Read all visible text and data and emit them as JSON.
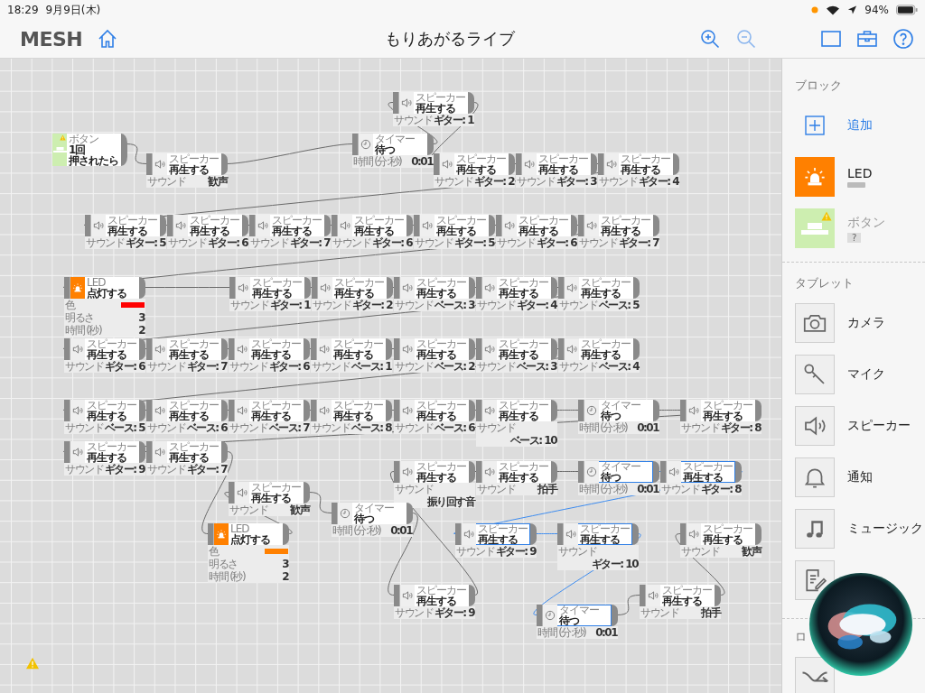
{
  "status_bar": {
    "time": "18:29",
    "date": "9月9日(木)",
    "battery": "94%"
  },
  "header": {
    "logo": "MESH",
    "title": "もりあがるライブ"
  },
  "nodes": [
    {
      "kind": "button",
      "title": "ボタン",
      "count": "1回",
      "action": "押されたら",
      "selected": false,
      "warning": true
    },
    {
      "kind": "speaker",
      "title": "スピーカー",
      "action": "再生する",
      "selected": false,
      "params": [
        {
          "label": "サウンド",
          "value": "歓声"
        }
      ]
    },
    {
      "kind": "timer",
      "title": "タイマー",
      "action": "待つ",
      "selected": false,
      "params": [
        {
          "label": "時間 (分:秒)",
          "value": "0:01"
        }
      ]
    },
    {
      "kind": "speaker",
      "title": "スピーカー",
      "action": "再生する",
      "selected": false,
      "params": [
        {
          "label": "サウンド",
          "value": "ギター: 1"
        }
      ]
    },
    {
      "kind": "speaker",
      "title": "スピーカー",
      "action": "再生する",
      "selected": false,
      "params": [
        {
          "label": "サウンド",
          "value": "ギター: 2"
        }
      ]
    },
    {
      "kind": "speaker",
      "title": "スピーカー",
      "action": "再生する",
      "selected": false,
      "params": [
        {
          "label": "サウンド",
          "value": "ギター: 3"
        }
      ]
    },
    {
      "kind": "speaker",
      "title": "スピーカー",
      "action": "再生する",
      "selected": false,
      "params": [
        {
          "label": "サウンド",
          "value": "ギター: 4"
        }
      ]
    },
    {
      "kind": "speaker",
      "title": "スピーカー",
      "action": "再生する",
      "selected": false,
      "params": [
        {
          "label": "サウンド",
          "value": "ギター: 5"
        }
      ]
    },
    {
      "kind": "speaker",
      "title": "スピーカー",
      "action": "再生する",
      "selected": false,
      "params": [
        {
          "label": "サウンド",
          "value": "ギター: 6"
        }
      ]
    },
    {
      "kind": "speaker",
      "title": "スピーカー",
      "action": "再生する",
      "selected": false,
      "params": [
        {
          "label": "サウンド",
          "value": "ギター: 7"
        }
      ]
    },
    {
      "kind": "speaker",
      "title": "スピーカー",
      "action": "再生する",
      "selected": false,
      "params": [
        {
          "label": "サウンド",
          "value": "ギター: 6"
        }
      ]
    },
    {
      "kind": "speaker",
      "title": "スピーカー",
      "action": "再生する",
      "selected": false,
      "params": [
        {
          "label": "サウンド",
          "value": "ギター: 5"
        }
      ]
    },
    {
      "kind": "speaker",
      "title": "スピーカー",
      "action": "再生する",
      "selected": false,
      "params": [
        {
          "label": "サウンド",
          "value": "ギター: 6"
        }
      ]
    },
    {
      "kind": "speaker",
      "title": "スピーカー",
      "action": "再生する",
      "selected": false,
      "params": [
        {
          "label": "サウンド",
          "value": "ギター: 7"
        }
      ]
    },
    {
      "kind": "led",
      "title": "LED",
      "action": "点灯する",
      "selected": false,
      "params": [
        {
          "label": "色",
          "color": "#ff0000"
        },
        {
          "label": "明るさ",
          "value": "3"
        },
        {
          "label": "時間 (秒)",
          "value": "2"
        }
      ]
    },
    {
      "kind": "speaker",
      "title": "スピーカー",
      "action": "再生する",
      "selected": false,
      "params": [
        {
          "label": "サウンド",
          "value": "ギター: 1"
        }
      ]
    },
    {
      "kind": "speaker",
      "title": "スピーカー",
      "action": "再生する",
      "selected": false,
      "params": [
        {
          "label": "サウンド",
          "value": "ギター: 2"
        }
      ]
    },
    {
      "kind": "speaker",
      "title": "スピーカー",
      "action": "再生する",
      "selected": false,
      "params": [
        {
          "label": "サウンド",
          "value": "ベース: 3"
        }
      ]
    },
    {
      "kind": "speaker",
      "title": "スピーカー",
      "action": "再生する",
      "selected": false,
      "params": [
        {
          "label": "サウンド",
          "value": "ギター: 4"
        }
      ]
    },
    {
      "kind": "speaker",
      "title": "スピーカー",
      "action": "再生する",
      "selected": false,
      "params": [
        {
          "label": "サウンド",
          "value": "ベース: 5"
        }
      ]
    },
    {
      "kind": "speaker",
      "title": "スピーカー",
      "action": "再生する",
      "selected": false,
      "params": [
        {
          "label": "サウンド",
          "value": "ギター: 6"
        }
      ]
    },
    {
      "kind": "speaker",
      "title": "スピーカー",
      "action": "再生する",
      "selected": false,
      "params": [
        {
          "label": "サウンド",
          "value": "ギター: 7"
        }
      ]
    },
    {
      "kind": "speaker",
      "title": "スピーカー",
      "action": "再生する",
      "selected": false,
      "params": [
        {
          "label": "サウンド",
          "value": "ギター: 6"
        }
      ]
    },
    {
      "kind": "speaker",
      "title": "スピーカー",
      "action": "再生する",
      "selected": false,
      "params": [
        {
          "label": "サウンド",
          "value": "ベース: 1"
        }
      ]
    },
    {
      "kind": "speaker",
      "title": "スピーカー",
      "action": "再生する",
      "selected": false,
      "params": [
        {
          "label": "サウンド",
          "value": "ベース: 2"
        }
      ]
    },
    {
      "kind": "speaker",
      "title": "スピーカー",
      "action": "再生する",
      "selected": false,
      "params": [
        {
          "label": "サウンド",
          "value": "ベース: 3"
        }
      ]
    },
    {
      "kind": "speaker",
      "title": "スピーカー",
      "action": "再生する",
      "selected": false,
      "params": [
        {
          "label": "サウンド",
          "value": "ベース: 4"
        }
      ]
    },
    {
      "kind": "speaker",
      "title": "スピーカー",
      "action": "再生する",
      "selected": false,
      "params": [
        {
          "label": "サウンド",
          "value": "ベース: 5"
        }
      ]
    },
    {
      "kind": "speaker",
      "title": "スピーカー",
      "action": "再生する",
      "selected": false,
      "params": [
        {
          "label": "サウンド",
          "value": "ベース: 6"
        }
      ]
    },
    {
      "kind": "speaker",
      "title": "スピーカー",
      "action": "再生する",
      "selected": false,
      "params": [
        {
          "label": "サウンド",
          "value": "ベース: 7"
        }
      ]
    },
    {
      "kind": "speaker",
      "title": "スピーカー",
      "action": "再生する",
      "selected": false,
      "params": [
        {
          "label": "サウンド",
          "value": "ベース: 8"
        }
      ]
    },
    {
      "kind": "speaker",
      "title": "スピーカー",
      "action": "再生する",
      "selected": false,
      "params": [
        {
          "label": "サウンド",
          "value": "ベース: 6"
        }
      ]
    },
    {
      "kind": "speaker",
      "title": "スピーカー",
      "action": "再生する",
      "selected": false,
      "params": [
        {
          "label": "サウンド",
          "value": "ベース: 10"
        }
      ]
    },
    {
      "kind": "timer",
      "title": "タイマー",
      "action": "待つ",
      "selected": false,
      "params": [
        {
          "label": "時間 (分:秒)",
          "value": "0:01"
        }
      ]
    },
    {
      "kind": "speaker",
      "title": "スピーカー",
      "action": "再生する",
      "selected": false,
      "params": [
        {
          "label": "サウンド",
          "value": "ギター: 8"
        }
      ]
    },
    {
      "kind": "speaker",
      "title": "スピーカー",
      "action": "再生する",
      "selected": false,
      "params": [
        {
          "label": "サウンド",
          "value": "ギター: 9"
        }
      ]
    },
    {
      "kind": "speaker",
      "title": "スピーカー",
      "action": "再生する",
      "selected": false,
      "params": [
        {
          "label": "サウンド",
          "value": "ギター: 7"
        }
      ]
    },
    {
      "kind": "speaker",
      "title": "スピーカー",
      "action": "再生する",
      "selected": false,
      "params": [
        {
          "label": "サウンド",
          "value": "振り回す音"
        }
      ]
    },
    {
      "kind": "speaker",
      "title": "スピーカー",
      "action": "再生する",
      "selected": false,
      "params": [
        {
          "label": "サウンド",
          "value": "拍手"
        }
      ]
    },
    {
      "kind": "timer",
      "title": "タイマー",
      "action": "待つ",
      "selected": true,
      "params": [
        {
          "label": "時間 (分:秒)",
          "value": "0:01"
        }
      ]
    },
    {
      "kind": "speaker",
      "title": "スピーカー",
      "action": "再生する",
      "selected": true,
      "params": [
        {
          "label": "サウンド",
          "value": "ギター: 8"
        }
      ]
    },
    {
      "kind": "speaker",
      "title": "スピーカー",
      "action": "再生する",
      "selected": false,
      "params": [
        {
          "label": "サウンド",
          "value": "歓声"
        }
      ]
    },
    {
      "kind": "timer",
      "title": "タイマー",
      "action": "待つ",
      "selected": false,
      "params": [
        {
          "label": "時間 (分:秒)",
          "value": "0:01"
        }
      ]
    },
    {
      "kind": "led",
      "title": "LED",
      "action": "点灯する",
      "selected": false,
      "params": [
        {
          "label": "色",
          "color": "#ff8000"
        },
        {
          "label": "明るさ",
          "value": "3"
        },
        {
          "label": "時間 (秒)",
          "value": "2"
        }
      ]
    },
    {
      "kind": "speaker",
      "title": "スピーカー",
      "action": "再生する",
      "selected": true,
      "params": [
        {
          "label": "サウンド",
          "value": "ギター: 9"
        }
      ]
    },
    {
      "kind": "speaker",
      "title": "スピーカー",
      "action": "再生する",
      "selected": true,
      "params": [
        {
          "label": "サウンド",
          "value": "ギター: 10"
        }
      ]
    },
    {
      "kind": "speaker",
      "title": "スピーカー",
      "action": "再生する",
      "selected": false,
      "params": [
        {
          "label": "サウンド",
          "value": "歓声"
        }
      ]
    },
    {
      "kind": "speaker",
      "title": "スピーカー",
      "action": "再生する",
      "selected": false,
      "params": [
        {
          "label": "サウンド",
          "value": "ギター: 9"
        }
      ]
    },
    {
      "kind": "speaker",
      "title": "スピーカー",
      "action": "再生する",
      "selected": false,
      "params": [
        {
          "label": "サウンド",
          "value": "拍手"
        }
      ]
    },
    {
      "kind": "timer",
      "title": "タイマー",
      "action": "待つ",
      "selected": true,
      "params": [
        {
          "label": "時間 (分:秒)",
          "value": "0:01"
        }
      ]
    }
  ],
  "canvas": {
    "warning": true
  },
  "sidebar": {
    "sections": [
      {
        "title": "ブロック",
        "add": "追加",
        "items": [
          {
            "kind": "led",
            "label": "LED",
            "disabled": false
          },
          {
            "kind": "button",
            "label": "ボタン",
            "badge": "?",
            "warning": true,
            "disabled": true
          }
        ]
      },
      {
        "title": "タブレット",
        "items": [
          {
            "kind": "camera",
            "label": "カメラ",
            "disabled": false
          },
          {
            "kind": "mic",
            "label": "マイク",
            "disabled": false
          },
          {
            "kind": "speaker",
            "label": "スピーカー",
            "disabled": false
          },
          {
            "kind": "bell",
            "label": "通知",
            "disabled": false
          },
          {
            "kind": "music",
            "label": "ミュージック",
            "disabled": false
          },
          {
            "kind": "file"
          }
        ]
      },
      {
        "title": "ロ",
        "items": [
          {
            "kind": "branch"
          }
        ]
      }
    ]
  }
}
